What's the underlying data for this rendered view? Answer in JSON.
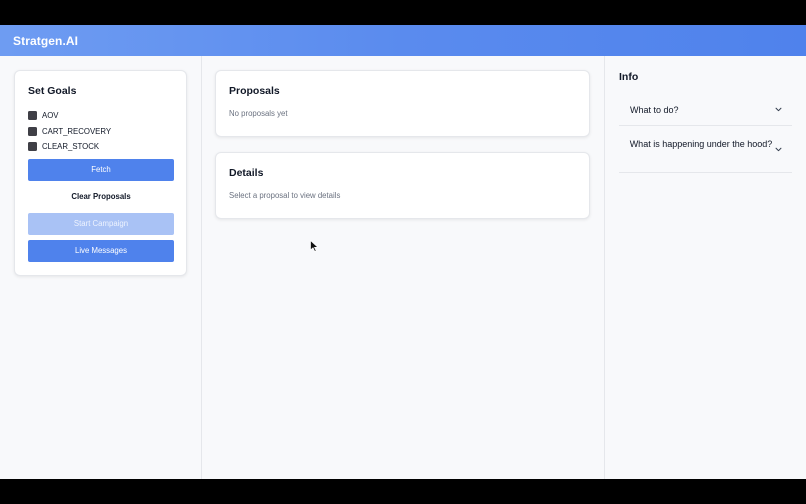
{
  "app": {
    "brand": "Stratgen.AI"
  },
  "goals": {
    "title": "Set Goals",
    "options": [
      {
        "label": "AOV",
        "checked": true
      },
      {
        "label": "CART_RECOVERY",
        "checked": true
      },
      {
        "label": "CLEAR_STOCK",
        "checked": true
      }
    ],
    "fetch_label": "Fetch",
    "clear_label": "Clear Proposals",
    "start_label": "Start Campaign",
    "live_label": "Live Messages"
  },
  "proposals": {
    "title": "Proposals",
    "empty_text": "No proposals yet"
  },
  "details": {
    "title": "Details",
    "empty_text": "Select a proposal to view details"
  },
  "info": {
    "title": "Info",
    "items": [
      {
        "label": "What to do?",
        "icon": "chevron-down-icon"
      },
      {
        "label": "What is happening under the hood?",
        "icon": "chevron-down-icon"
      }
    ]
  },
  "colors": {
    "accent": "#4f82ec",
    "accent_disabled": "#a9c2f5",
    "checkbox": "#3f3f46"
  }
}
